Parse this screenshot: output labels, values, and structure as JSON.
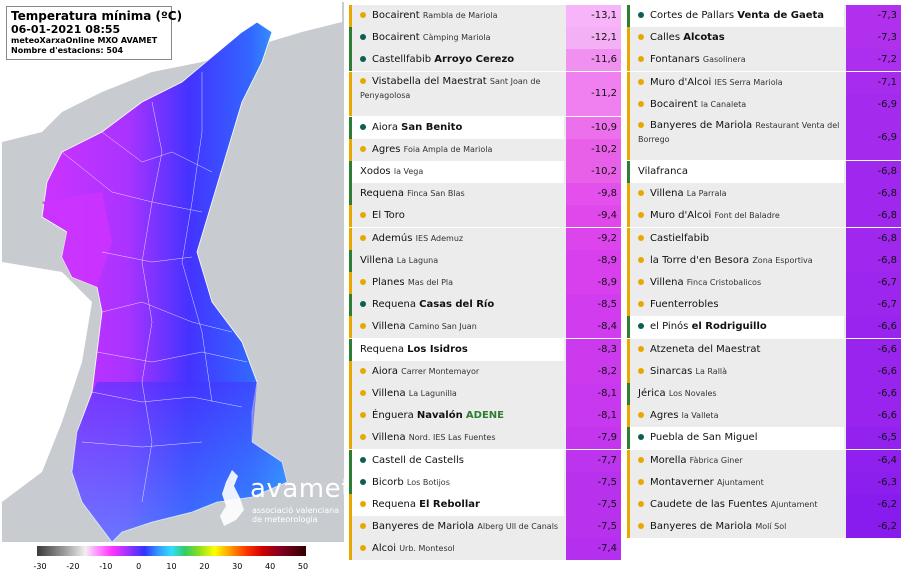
{
  "map": {
    "title": "Temperatura mínima (ºC)",
    "datetime": "06-01-2021 08:55",
    "source": "meteoXarxaOnline MXO AVAMET",
    "stations": "Nombre d'estacions: 504",
    "logo_word": "avamet",
    "logo_sub1": "associació valenciana",
    "logo_sub2": "de meteorologia",
    "colors": {
      "sea": "#c8ccd0",
      "land_cold": "#cc33ff",
      "land_mid": "#3355ff",
      "coast": "#3399ff"
    }
  },
  "scale": {
    "ticks": [
      "-30",
      "-20",
      "-10",
      "0",
      "10",
      "20",
      "30",
      "40",
      "50"
    ]
  },
  "left_table": [
    {
      "name": "Bocairent",
      "sub": "Rambla de Mariola",
      "value": "-13,1",
      "marker": "dot-orange",
      "white": false,
      "color": "#f8b4f8"
    },
    {
      "name": "Bocairent",
      "sub": "Càmping Mariola",
      "value": "-12,1",
      "marker": "dot-green",
      "white": false,
      "color": "#f4b0f4"
    },
    {
      "name": "Castellfabib",
      "bold": "Arroyo Cerezo",
      "value": "-11,6",
      "marker": "dot-green",
      "white": false,
      "color": "#f090f0"
    },
    {
      "name": "Vistabella del Maestrat",
      "sub": "Sant Joan de Penyagolosa",
      "value": "-11,2",
      "marker": "dot-orange",
      "white": false,
      "color": "#f080f0",
      "tall": true
    },
    {
      "name": "Aiora",
      "bold": "San Benito",
      "value": "-10,9",
      "marker": "dot-green",
      "white": true,
      "color": "#ec70ec"
    },
    {
      "name": "Agres",
      "sub": "Foia Ampla de Mariola",
      "value": "-10,2",
      "marker": "dot-orange",
      "white": false,
      "color": "#e860e8"
    },
    {
      "name": "Xodos",
      "sub": "la Vega",
      "value": "-10,2",
      "marker": "bar-green",
      "white": true,
      "color": "#e860e8"
    },
    {
      "name": "Requena",
      "sub": "Finca San Blas",
      "value": "-9,8",
      "marker": "bar-green",
      "white": false,
      "color": "#e450ec"
    },
    {
      "name": "El Toro",
      "value": "-9,4",
      "marker": "dot-orange",
      "white": false,
      "color": "#e048ec"
    },
    {
      "name": "Ademús",
      "sub": "IES Ademuz",
      "value": "-9,2",
      "marker": "dot-orange",
      "white": false,
      "color": "#dc44ec"
    },
    {
      "name": "Villena",
      "sub": "La Laguna",
      "value": "-8,9",
      "marker": "bar-green",
      "white": false,
      "color": "#d840ee"
    },
    {
      "name": "Planes",
      "sub": "Mas del Pla",
      "value": "-8,9",
      "marker": "dot-orange",
      "white": false,
      "color": "#d840ee"
    },
    {
      "name": "Requena",
      "bold": "Casas del Río",
      "value": "-8,5",
      "marker": "dot-green",
      "white": false,
      "color": "#d03cee"
    },
    {
      "name": "Villena",
      "sub": "Camino San Juan",
      "value": "-8,4",
      "marker": "dot-orange",
      "white": false,
      "color": "#d03cee"
    },
    {
      "name": "Requena",
      "bold": "Los Isidros",
      "value": "-8,3",
      "marker": "bar-green",
      "white": true,
      "color": "#cc3aee"
    },
    {
      "name": "Aiora",
      "sub": "Carrer Montemayor",
      "value": "-8,2",
      "marker": "dot-orange",
      "white": false,
      "color": "#cc3aee"
    },
    {
      "name": "Villena",
      "sub": "La Lagunilla",
      "value": "-8,1",
      "marker": "dot-orange",
      "white": false,
      "color": "#c838ee"
    },
    {
      "name": "Énguera",
      "bold": "Navalón",
      "green": "ADENE",
      "value": "-8,1",
      "marker": "dot-orange",
      "white": false,
      "color": "#c838ee"
    },
    {
      "name": "Villena",
      "sub": "Nord. IES Las Fuentes",
      "value": "-7,9",
      "marker": "dot-orange",
      "white": false,
      "color": "#c436ee"
    },
    {
      "name": "Castell de Castells",
      "value": "-7,7",
      "marker": "dot-green",
      "white": true,
      "color": "#bc34ee"
    },
    {
      "name": "Bicorb",
      "sub": "Los Botijos",
      "value": "-7,5",
      "marker": "dot-green",
      "white": true,
      "color": "#b832ee"
    },
    {
      "name": "Requena",
      "bold": "El Rebollar",
      "value": "-7,5",
      "marker": "dot-orange",
      "white": true,
      "color": "#b832ee"
    },
    {
      "name": "Banyeres de Mariola",
      "sub": "Alberg Ull de Canals",
      "value": "-7,5",
      "marker": "dot-orange",
      "white": false,
      "color": "#b832ee"
    },
    {
      "name": "Alcoi",
      "sub": "Urb. Montesol",
      "value": "-7,4",
      "marker": "dot-orange",
      "white": false,
      "color": "#b430ee"
    }
  ],
  "right_table": [
    {
      "name": "Cortes de Pallars",
      "bold": "Venta de Gaeta",
      "value": "-7,3",
      "marker": "dot-green",
      "white": true,
      "color": "#b030ee"
    },
    {
      "name": "Calles",
      "bold": "Alcotas",
      "value": "-7,3",
      "marker": "dot-orange",
      "white": false,
      "color": "#b030ee"
    },
    {
      "name": "Fontanars",
      "sub": "Gasolinera",
      "value": "-7,2",
      "marker": "dot-orange",
      "white": false,
      "color": "#ac2eee"
    },
    {
      "name": "Muro d'Alcoi",
      "sub": "IES Serra Mariola",
      "value": "-7,1",
      "marker": "dot-orange",
      "white": false,
      "color": "#a82cee"
    },
    {
      "name": "Bocairent",
      "sub": "la Canaleta",
      "value": "-6,9",
      "marker": "dot-orange",
      "white": false,
      "color": "#a42aee"
    },
    {
      "name": "Banyeres de Mariola",
      "sub": "Restaurant Venta del Borrego",
      "value": "-6,9",
      "marker": "dot-orange",
      "white": false,
      "color": "#a42aee",
      "tall": true
    },
    {
      "name": "Vilafranca",
      "value": "-6,8",
      "marker": "bar-green",
      "white": true,
      "color": "#a028ee"
    },
    {
      "name": "Villena",
      "sub": "La Parrala",
      "value": "-6,8",
      "marker": "dot-orange",
      "white": false,
      "color": "#a028ee"
    },
    {
      "name": "Muro d'Alcoi",
      "sub": "Font del Baladre",
      "value": "-6,8",
      "marker": "dot-orange",
      "white": false,
      "color": "#a028ee"
    },
    {
      "name": "Castielfabib",
      "value": "-6,8",
      "marker": "dot-orange",
      "white": false,
      "color": "#a028ee"
    },
    {
      "name": "la Torre d'en Besora",
      "sub": "Zona Esportiva",
      "value": "-6,8",
      "marker": "dot-orange",
      "white": false,
      "color": "#a028ee"
    },
    {
      "name": "Villena",
      "sub": "Finca Cristobalicos",
      "value": "-6,7",
      "marker": "dot-orange",
      "white": false,
      "color": "#9c26ee"
    },
    {
      "name": "Fuenterrobles",
      "value": "-6,7",
      "marker": "dot-orange",
      "white": false,
      "color": "#9c26ee"
    },
    {
      "name": "el Pinós",
      "bold": "el Rodriguillo",
      "value": "-6,6",
      "marker": "dot-green",
      "white": true,
      "color": "#9824ee"
    },
    {
      "name": "Atzeneta del Maestrat",
      "value": "-6,6",
      "marker": "dot-orange",
      "white": false,
      "color": "#9824ee"
    },
    {
      "name": "Sinarcas",
      "sub": "La Rallà",
      "value": "-6,6",
      "marker": "dot-orange",
      "white": false,
      "color": "#9824ee"
    },
    {
      "name": "Jérica",
      "sub": "Los Novales",
      "value": "-6,6",
      "marker": "bar-green",
      "white": false,
      "color": "#9824ee"
    },
    {
      "name": "Agres",
      "sub": "la Valleta",
      "value": "-6,6",
      "marker": "dot-orange",
      "white": false,
      "color": "#9824ee"
    },
    {
      "name": "Puebla de San Miguel",
      "value": "-6,5",
      "marker": "dot-green",
      "white": true,
      "color": "#9422ee"
    },
    {
      "name": "Morella",
      "sub": "Fàbrica Giner",
      "value": "-6,4",
      "marker": "dot-orange",
      "white": false,
      "color": "#9020ee"
    },
    {
      "name": "Montaverner",
      "sub": "Ajuntament",
      "value": "-6,3",
      "marker": "dot-orange",
      "white": false,
      "color": "#8c1eee"
    },
    {
      "name": "Caudete de las Fuentes",
      "sub": "Ajuntament",
      "value": "-6,2",
      "marker": "dot-orange",
      "white": false,
      "color": "#881cee"
    },
    {
      "name": "Banyeres de Mariola",
      "sub": "Molí Sol",
      "value": "-6,2",
      "marker": "dot-orange",
      "white": false,
      "color": "#881cee"
    }
  ]
}
